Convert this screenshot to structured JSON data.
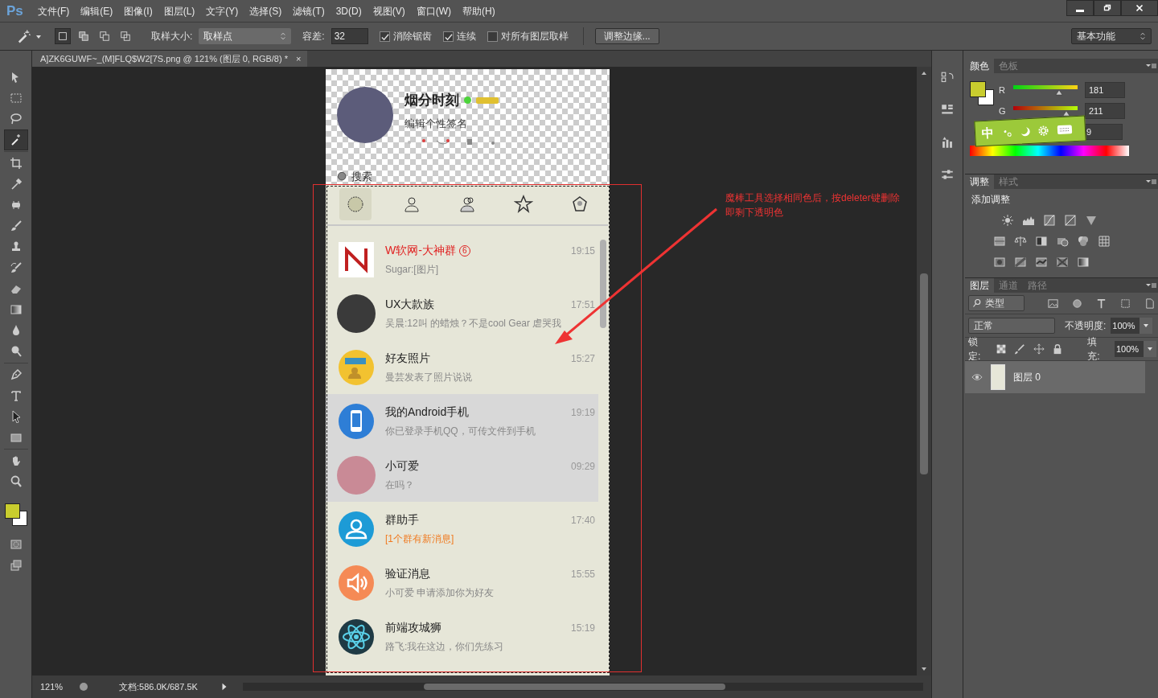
{
  "app": {
    "logo": "Ps",
    "menus": [
      "文件(F)",
      "编辑(E)",
      "图像(I)",
      "图层(L)",
      "文字(Y)",
      "选择(S)",
      "滤镜(T)",
      "3D(D)",
      "视图(V)",
      "窗口(W)",
      "帮助(H)"
    ]
  },
  "options_bar": {
    "sample_size_label": "取样大小:",
    "sample_size": "取样点",
    "tolerance_label": "容差:",
    "tolerance": "32",
    "checkboxes": [
      {
        "label": "消除锯齿",
        "checked": true
      },
      {
        "label": "连续",
        "checked": true
      },
      {
        "label": "对所有图层取样",
        "checked": false
      }
    ],
    "refine_button": "调整边缘...",
    "workspace": "基本功能"
  },
  "tools": [
    {
      "kind": "move",
      "selected": false
    },
    {
      "kind": "marquee",
      "selected": false
    },
    {
      "kind": "lasso",
      "selected": false
    },
    {
      "kind": "wand",
      "selected": true
    },
    {
      "kind": "crop",
      "selected": false
    },
    {
      "kind": "eyedropper",
      "selected": false
    },
    {
      "kind": "heal",
      "selected": false
    },
    {
      "kind": "brush",
      "selected": false
    },
    {
      "kind": "stamp",
      "selected": false
    },
    {
      "kind": "history",
      "selected": false
    },
    {
      "kind": "eraser",
      "selected": false
    },
    {
      "kind": "gradient",
      "selected": false
    },
    {
      "kind": "blur",
      "selected": false
    },
    {
      "kind": "dodge",
      "selected": false
    },
    {
      "kind": "pen",
      "selected": false
    },
    {
      "kind": "type",
      "selected": false
    },
    {
      "kind": "select",
      "selected": false
    },
    {
      "kind": "shape",
      "selected": false
    },
    {
      "kind": "hand",
      "selected": false
    },
    {
      "kind": "zoom",
      "selected": false
    }
  ],
  "document_tab": {
    "title": "A]ZK6GUWF~_(M]FLQ$W2[7S.png @ 121% (图层 0, RGB/8) *",
    "close": "×"
  },
  "image": {
    "profile": {
      "name": "烟分时刻",
      "signature": "编辑个性签名",
      "online": true
    },
    "search": "搜索",
    "tabs": [
      {
        "kind": "chat",
        "selected": true
      },
      {
        "kind": "contact",
        "selected": false
      },
      {
        "kind": "group",
        "selected": false
      },
      {
        "kind": "star",
        "selected": false
      },
      {
        "kind": "space",
        "selected": false
      }
    ],
    "chats": [
      {
        "name": "W软网-大神群",
        "badge": "6",
        "time": "19:15",
        "message": "Sugar:[图片]",
        "alert": true,
        "notice": false,
        "selected": false,
        "kind": "logo",
        "color": "#ffffff"
      },
      {
        "name": "UX大款族",
        "time": "17:51",
        "message": "吴晨:12叫 的蜡烛？不是cool Gear 虐哭我",
        "alert": false,
        "notice": false,
        "selected": false,
        "kind": "photo",
        "color": "#3a3a3a"
      },
      {
        "name": "好友照片",
        "time": "15:27",
        "message": "曼芸发表了照片说说",
        "alert": false,
        "notice": false,
        "selected": false,
        "kind": "people",
        "color": "#f2c230"
      },
      {
        "name": "我的Android手机",
        "time": "19:19",
        "message": "你已登录手机QQ，可传文件到手机",
        "alert": false,
        "notice": false,
        "selected": true,
        "kind": "phone",
        "color": "#2e7ed6"
      },
      {
        "name": "小可爱",
        "time": "09:29",
        "message": "在吗？",
        "alert": false,
        "notice": false,
        "selected": true,
        "kind": "photo",
        "color": "#c98a96"
      },
      {
        "name": "群助手",
        "time": "17:40",
        "message": "[1个群有新消息]",
        "alert": false,
        "notice": true,
        "selected": false,
        "kind": "group",
        "color": "#1d9bd6"
      },
      {
        "name": "验证消息",
        "time": "15:55",
        "message": "小可爱 申请添加你为好友",
        "alert": false,
        "notice": false,
        "selected": false,
        "kind": "speaker",
        "color": "#f58a55"
      },
      {
        "name": "前端攻城狮",
        "time": "15:19",
        "message": "路飞:我在这边，你们先练习",
        "alert": false,
        "notice": false,
        "selected": false,
        "kind": "atom",
        "color": "#1f3a44"
      }
    ]
  },
  "annotation": {
    "lines": [
      "魔棒工具选择相同色后，按deleter键删除",
      "即剩下透明色"
    ]
  },
  "color_panel": {
    "tabs": [
      {
        "label": "颜色",
        "selected": true
      },
      {
        "label": "色板",
        "selected": false
      }
    ],
    "channels": [
      {
        "label": "R",
        "value": "181",
        "level": 0.71
      },
      {
        "label": "G",
        "value": "211",
        "level": 0.83
      }
    ],
    "b_value": "9"
  },
  "ime_toolbar": {
    "label": "中"
  },
  "adjustments_panel": {
    "tabs": [
      {
        "label": "调整",
        "selected": true
      },
      {
        "label": "样式",
        "selected": false
      }
    ],
    "title": "添加调整"
  },
  "layers_panel": {
    "tabs": [
      {
        "label": "图层",
        "selected": true
      },
      {
        "label": "通道",
        "selected": false
      },
      {
        "label": "路径",
        "selected": false
      }
    ],
    "filter": "类型",
    "blend_mode": "正常",
    "opacity_label": "不透明度:",
    "opacity": "100%",
    "lock_label": "锁定:",
    "fill_label": "填充:",
    "fill": "100%",
    "layers": [
      {
        "name": "图层 0",
        "visible": true,
        "selected": true
      }
    ]
  },
  "status_bar": {
    "zoom": "121%",
    "doc_info": "文档:586.0K/687.5K"
  }
}
